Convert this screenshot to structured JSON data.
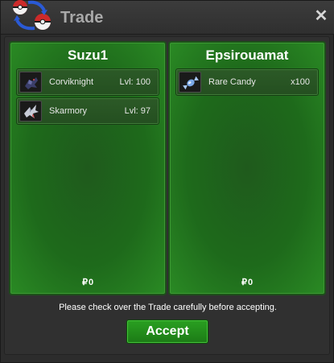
{
  "window": {
    "title": "Trade",
    "close_symbol": "✕"
  },
  "left_panel": {
    "player_name": "Suzu1",
    "items": [
      {
        "name": "Corviknight",
        "meta": "Lvl: 100",
        "icon": "corviknight-icon"
      },
      {
        "name": "Skarmory",
        "meta": "Lvl: 97",
        "icon": "skarmory-icon"
      }
    ],
    "money": "0",
    "currency_symbol": "₽"
  },
  "right_panel": {
    "player_name": "Epsirouamat",
    "items": [
      {
        "name": "Rare Candy",
        "meta": "x100",
        "icon": "rare-candy-icon"
      }
    ],
    "money": "0",
    "currency_symbol": "₽"
  },
  "notice": "Please check over the Trade carefully before accepting.",
  "accept_label": "Accept",
  "colors": {
    "panel_green": "#1e6a1b",
    "button_green": "#2aa021",
    "background": "#2c2c2c"
  }
}
